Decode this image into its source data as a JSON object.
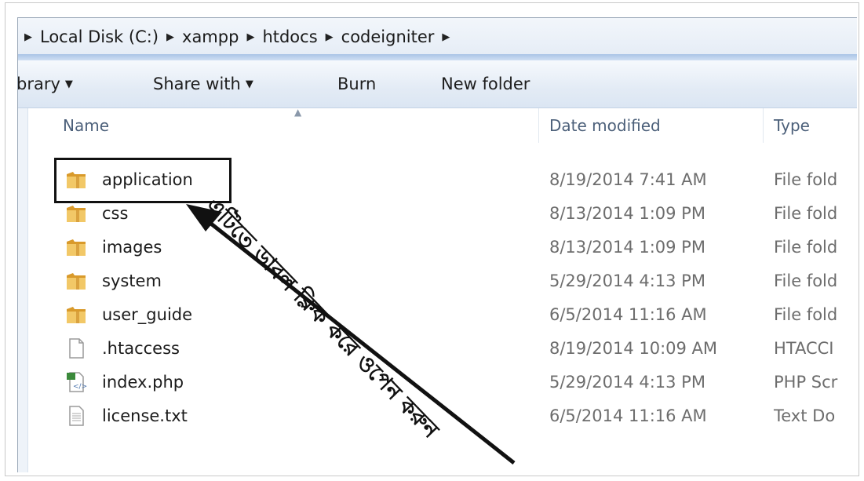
{
  "breadcrumb": {
    "items": [
      "Local Disk (C:)",
      "xampp",
      "htdocs",
      "codeigniter"
    ]
  },
  "toolbar": {
    "library_label": "brary",
    "share_label": "Share with",
    "burn_label": "Burn",
    "new_folder_label": "New folder"
  },
  "columns": {
    "name": "Name",
    "date": "Date modified",
    "type": "Type"
  },
  "files": [
    {
      "icon": "folder-icon",
      "name": "application",
      "date": "8/19/2014 7:41 AM",
      "type": "File fold"
    },
    {
      "icon": "folder-icon",
      "name": "css",
      "date": "8/13/2014 1:09 PM",
      "type": "File fold"
    },
    {
      "icon": "folder-icon",
      "name": "images",
      "date": "8/13/2014 1:09 PM",
      "type": "File fold"
    },
    {
      "icon": "folder-icon",
      "name": "system",
      "date": "5/29/2014 4:13 PM",
      "type": "File fold"
    },
    {
      "icon": "folder-icon",
      "name": "user_guide",
      "date": "6/5/2014 11:16 AM",
      "type": "File fold"
    },
    {
      "icon": "blank-file-icon",
      "name": ".htaccess",
      "date": "8/19/2014 10:09 AM",
      "type": "HTACCI"
    },
    {
      "icon": "php-file-icon",
      "name": "index.php",
      "date": "5/29/2014 4:13 PM",
      "type": "PHP Scr"
    },
    {
      "icon": "text-file-icon",
      "name": "license.txt",
      "date": "6/5/2014 11:16 AM",
      "type": "Text Do"
    }
  ],
  "annotation": {
    "text": "এটিতে ডাবল ক্লিক করে ওপেন করুন"
  },
  "colors": {
    "folder": "#e8b64a",
    "header_text": "#4c607a",
    "meta_text": "#6d6d6d"
  }
}
